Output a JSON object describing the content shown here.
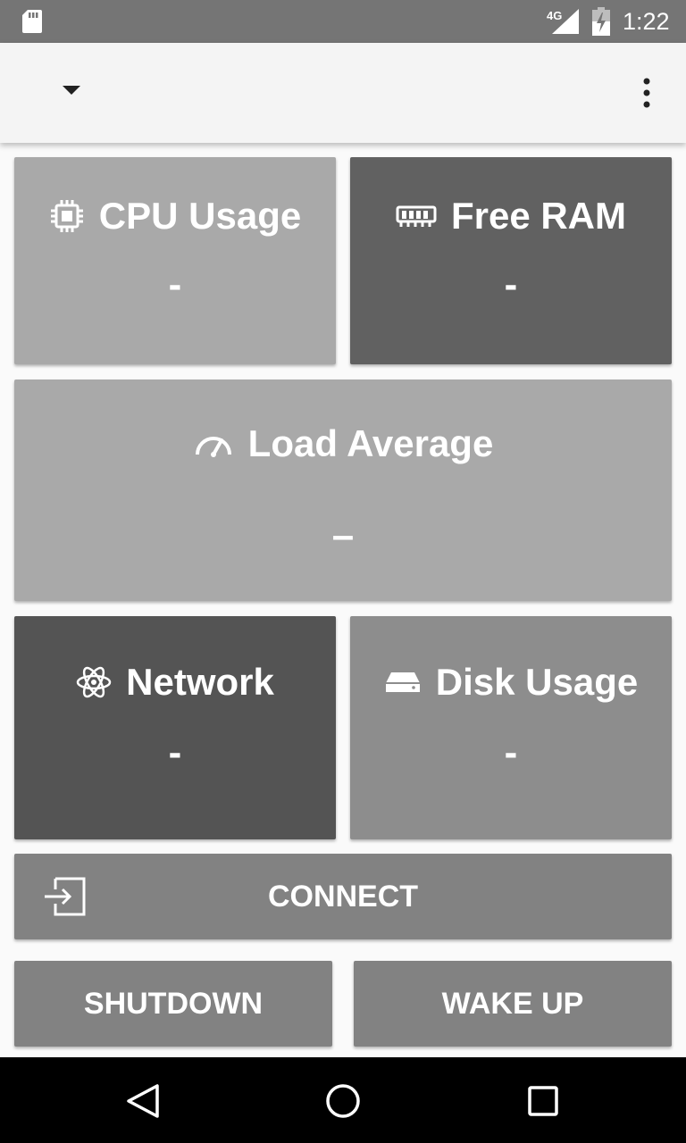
{
  "status_bar": {
    "network": "4G",
    "time": "1:22"
  },
  "app_bar": {
    "dropdown_icon": "arrow-drop-down",
    "menu_icon": "more-vertical"
  },
  "tiles": {
    "cpu": {
      "title": "CPU Usage",
      "value": "-",
      "icon": "chip-icon",
      "color": "#a9a9a9"
    },
    "ram": {
      "title": "Free RAM",
      "value": "-",
      "icon": "memory-icon",
      "color": "#616161"
    },
    "load": {
      "title": "Load Average",
      "value": "–",
      "icon": "speedometer-icon",
      "color": "#a9a9a9"
    },
    "network": {
      "title": "Network",
      "value": "-",
      "icon": "atom-icon",
      "color": "#545454"
    },
    "disk": {
      "title": "Disk Usage",
      "value": "-",
      "icon": "harddisk-icon",
      "color": "#8d8d8d"
    }
  },
  "buttons": {
    "connect": "CONNECT",
    "shutdown": "SHUTDOWN",
    "wakeup": "WAKE UP"
  },
  "nav": {
    "back": "back-icon",
    "home": "home-icon",
    "recent": "recent-apps-icon"
  }
}
